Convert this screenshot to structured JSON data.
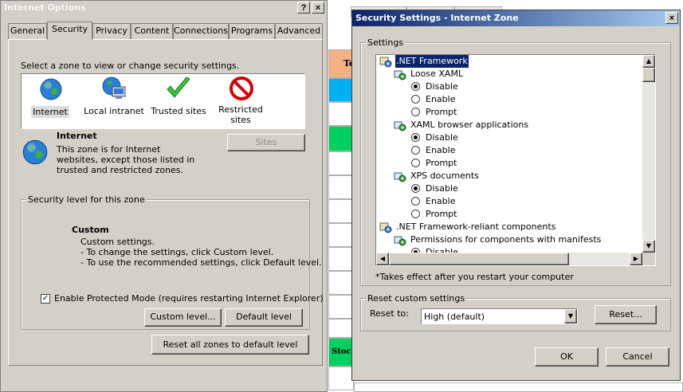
{
  "background_sheet": {
    "cells": [
      "Te",
      "Stock"
    ]
  },
  "internet_options": {
    "title": "Internet Options",
    "help_btn": "?",
    "close_btn": "×",
    "tabs": [
      {
        "label": "General"
      },
      {
        "label": "Security"
      },
      {
        "label": "Privacy"
      },
      {
        "label": "Content"
      },
      {
        "label": "Connections"
      },
      {
        "label": "Programs"
      },
      {
        "label": "Advanced"
      }
    ],
    "zone_prompt": "Select a zone to view or change security settings.",
    "zones": [
      {
        "label": "Internet",
        "icon": "globe-icon"
      },
      {
        "label": "Local intranet",
        "icon": "intranet-icon"
      },
      {
        "label": "Trusted sites",
        "icon": "checkmark-icon"
      },
      {
        "label": "Restricted sites",
        "icon": "restricted-icon"
      }
    ],
    "zone_info": {
      "title": "Internet",
      "description": "This zone is for Internet websites, except those listed in trusted and restricted zones."
    },
    "sites_btn": "Sites",
    "security_level": {
      "group_label": "Security level for this zone",
      "level_title": "Custom",
      "lines": [
        "Custom settings.",
        "- To change the settings, click Custom level.",
        "- To use the recommended settings, click Default level."
      ]
    },
    "protected_mode": {
      "label": "Enable Protected Mode (requires restarting Internet Explorer)",
      "checked": true
    },
    "custom_level_btn": "Custom level...",
    "default_level_btn": "Default level",
    "reset_all_btn": "Reset all zones to default level"
  },
  "security_settings": {
    "title": "Security Settings - Internet Zone",
    "close_btn": "×",
    "settings_label": "Settings",
    "tree": [
      {
        "type": "category",
        "label": ".NET Framework",
        "indent": 0,
        "selected": true
      },
      {
        "type": "setting",
        "label": "Loose XAML",
        "indent": 1
      },
      {
        "type": "option",
        "label": "Disable",
        "indent": 2,
        "checked": true
      },
      {
        "type": "option",
        "label": "Enable",
        "indent": 2,
        "checked": false
      },
      {
        "type": "option",
        "label": "Prompt",
        "indent": 2,
        "checked": false
      },
      {
        "type": "setting",
        "label": "XAML browser applications",
        "indent": 1
      },
      {
        "type": "option",
        "label": "Disable",
        "indent": 2,
        "checked": true
      },
      {
        "type": "option",
        "label": "Enable",
        "indent": 2,
        "checked": false
      },
      {
        "type": "option",
        "label": "Prompt",
        "indent": 2,
        "checked": false
      },
      {
        "type": "setting",
        "label": "XPS documents",
        "indent": 1
      },
      {
        "type": "option",
        "label": "Disable",
        "indent": 2,
        "checked": true
      },
      {
        "type": "option",
        "label": "Enable",
        "indent": 2,
        "checked": false
      },
      {
        "type": "option",
        "label": "Prompt",
        "indent": 2,
        "checked": false
      },
      {
        "type": "category",
        "label": ".NET Framework-reliant components",
        "indent": 0,
        "selected": false
      },
      {
        "type": "setting",
        "label": "Permissions for components with manifests",
        "indent": 1
      },
      {
        "type": "option",
        "label": "Disable",
        "indent": 2,
        "checked": true
      }
    ],
    "note": "*Takes effect after you restart your computer",
    "reset_group_label": "Reset custom settings",
    "reset_to_label": "Reset to:",
    "reset_to_value": "High (default)",
    "reset_btn": "Reset...",
    "ok_btn": "OK",
    "cancel_btn": "Cancel"
  }
}
